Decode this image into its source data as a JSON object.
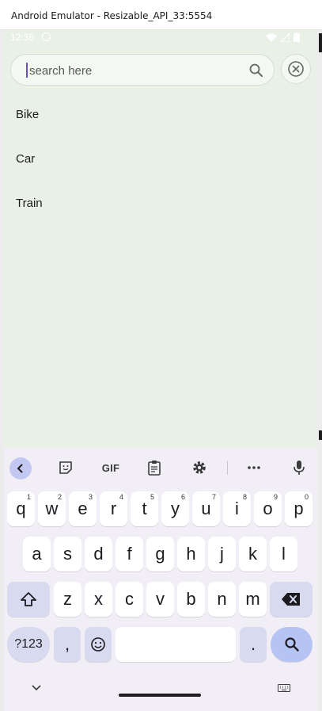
{
  "window": {
    "title": "Android Emulator - Resizable_API_33:5554"
  },
  "status_bar": {
    "time": "12:38"
  },
  "search": {
    "placeholder": "search here",
    "value": ""
  },
  "list": {
    "items": [
      "Bike",
      "Car",
      "Train"
    ]
  },
  "keyboard": {
    "toolbar": {
      "gif_label": "GIF"
    },
    "row1": [
      {
        "key": "q",
        "hint": "1"
      },
      {
        "key": "w",
        "hint": "2"
      },
      {
        "key": "e",
        "hint": "3"
      },
      {
        "key": "r",
        "hint": "4"
      },
      {
        "key": "t",
        "hint": "5"
      },
      {
        "key": "y",
        "hint": "6"
      },
      {
        "key": "u",
        "hint": "7"
      },
      {
        "key": "i",
        "hint": "8"
      },
      {
        "key": "o",
        "hint": "9"
      },
      {
        "key": "p",
        "hint": "0"
      }
    ],
    "row2": [
      "a",
      "s",
      "d",
      "f",
      "g",
      "h",
      "j",
      "k",
      "l"
    ],
    "row3": [
      "z",
      "x",
      "c",
      "v",
      "b",
      "n",
      "m"
    ],
    "row4": {
      "symbols_label": "?123",
      "comma": ",",
      "period": "."
    }
  },
  "colors": {
    "app_background": "#e9f1e6",
    "keyboard_background": "#f1eef6",
    "accent": "#b6c4f4"
  }
}
